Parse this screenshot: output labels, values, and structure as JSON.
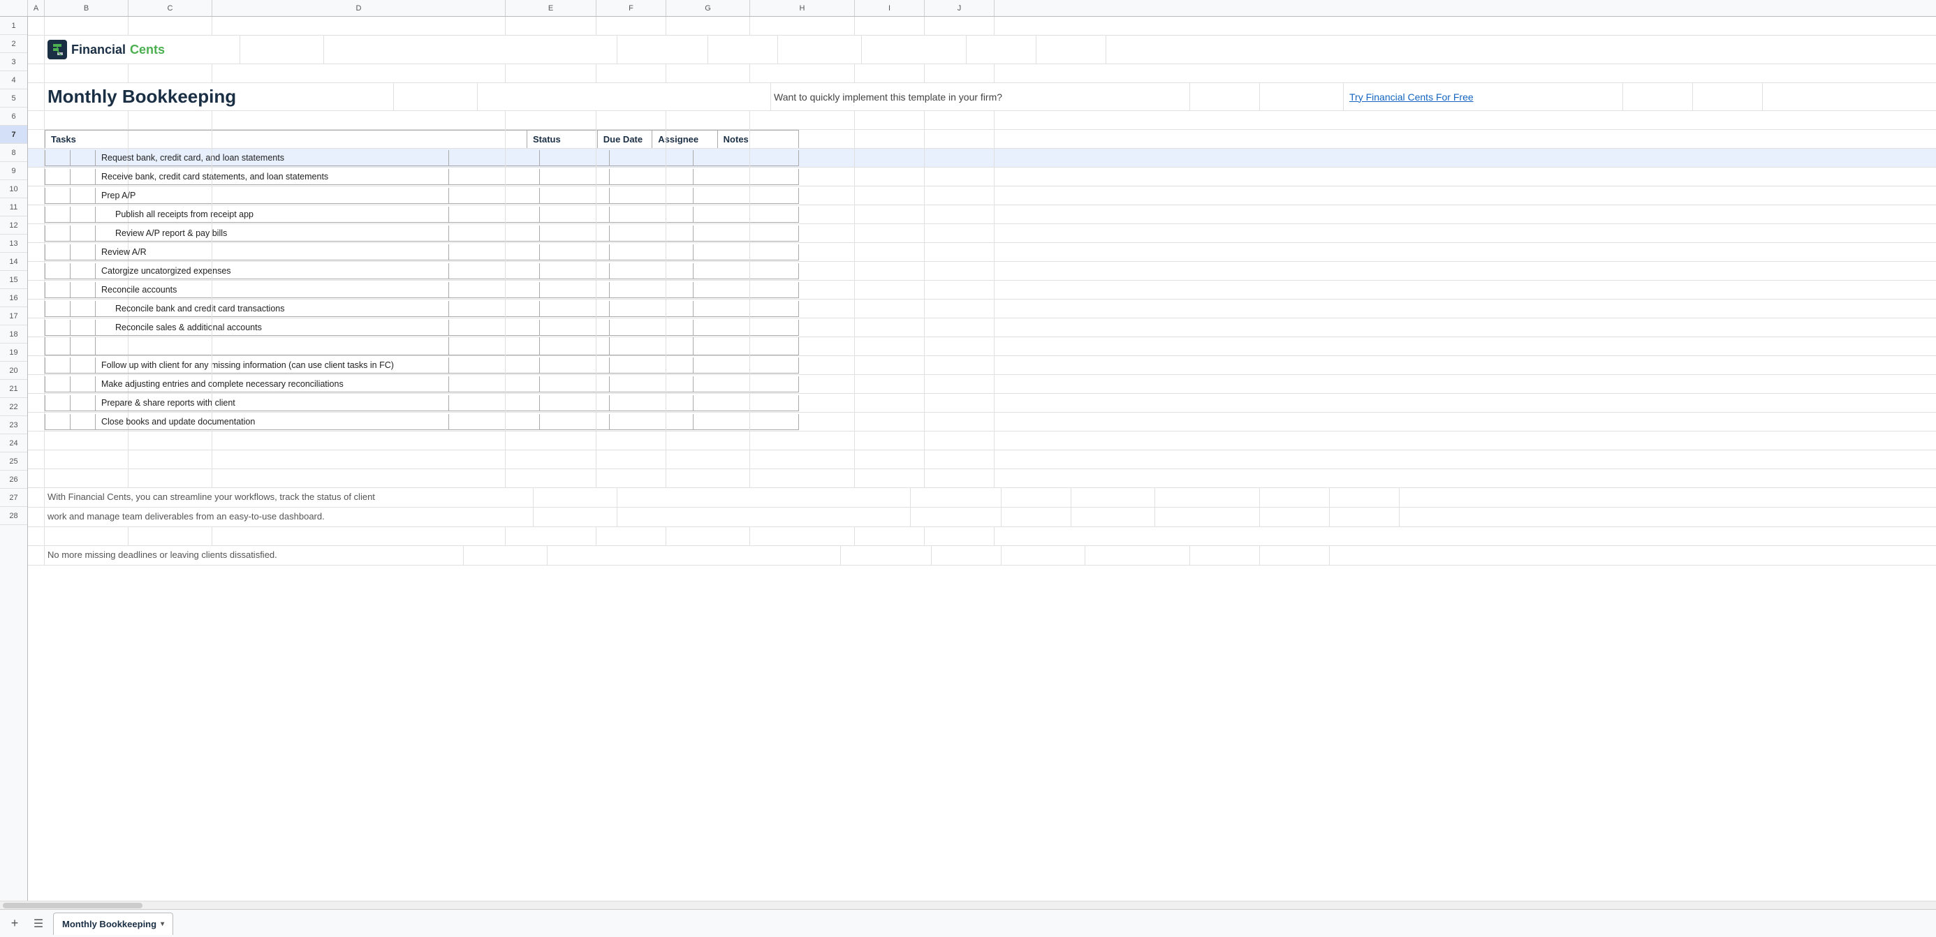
{
  "brand": {
    "name_financial": "Financial",
    "name_cents": "Cents",
    "logo_alt": "FinancialCents logo"
  },
  "header": {
    "title": "Monthly Bookkeeping",
    "cta_text": "Want to quickly implement this template in your firm?",
    "cta_link_text": "Try Financial Cents For Free"
  },
  "columns": {
    "letters": [
      "A",
      "B",
      "C",
      "D",
      "E",
      "F",
      "G",
      "H",
      "I",
      "J"
    ]
  },
  "row_numbers": [
    1,
    2,
    3,
    4,
    5,
    6,
    7,
    8,
    9,
    10,
    11,
    12,
    13,
    14,
    15,
    16,
    17,
    18,
    19,
    20,
    21,
    22,
    23,
    24,
    25,
    26,
    27,
    28
  ],
  "selected_row": 7,
  "table": {
    "headers": [
      "Tasks",
      "Status",
      "Due Date",
      "Assignee",
      "Notes"
    ],
    "rows": [
      {
        "indent": 0,
        "task": "Request bank, credit card, and loan statements",
        "status": "",
        "due_date": "",
        "assignee": "",
        "notes": ""
      },
      {
        "indent": 0,
        "task": "Receive bank, credit card statements, and loan statements",
        "status": "",
        "due_date": "",
        "assignee": "",
        "notes": ""
      },
      {
        "indent": 0,
        "task": "Prep A/P",
        "status": "",
        "due_date": "",
        "assignee": "",
        "notes": ""
      },
      {
        "indent": 1,
        "task": "Publish all receipts from receipt app",
        "status": "",
        "due_date": "",
        "assignee": "",
        "notes": ""
      },
      {
        "indent": 1,
        "task": "Review A/P report & pay bills",
        "status": "",
        "due_date": "",
        "assignee": "",
        "notes": ""
      },
      {
        "indent": 0,
        "task": "Review A/R",
        "status": "",
        "due_date": "",
        "assignee": "",
        "notes": ""
      },
      {
        "indent": 0,
        "task": "Catorgize uncatorgized expenses",
        "status": "",
        "due_date": "",
        "assignee": "",
        "notes": ""
      },
      {
        "indent": 0,
        "task": "Reconcile accounts",
        "status": "",
        "due_date": "",
        "assignee": "",
        "notes": ""
      },
      {
        "indent": 1,
        "task": "Reconcile bank and credit card transactions",
        "status": "",
        "due_date": "",
        "assignee": "",
        "notes": ""
      },
      {
        "indent": 1,
        "task": "Reconcile sales & additional accounts",
        "status": "",
        "due_date": "",
        "assignee": "",
        "notes": ""
      },
      {
        "indent": 0,
        "task": "",
        "status": "",
        "due_date": "",
        "assignee": "",
        "notes": ""
      },
      {
        "indent": 0,
        "task": "Follow up with client for any missing information (can use client tasks in FC)",
        "status": "",
        "due_date": "",
        "assignee": "",
        "notes": ""
      },
      {
        "indent": 0,
        "task": "Make adjusting entries and complete necessary reconciliations",
        "status": "",
        "due_date": "",
        "assignee": "",
        "notes": ""
      },
      {
        "indent": 0,
        "task": "Prepare & share reports with client",
        "status": "",
        "due_date": "",
        "assignee": "",
        "notes": ""
      },
      {
        "indent": 0,
        "task": "Close books and update documentation",
        "status": "",
        "due_date": "",
        "assignee": "",
        "notes": ""
      }
    ]
  },
  "promo": {
    "line1": "With Financial Cents, you can streamline your workflows, track the status of client",
    "line2": "work and manage team deliverables from an easy-to-use dashboard.",
    "line3": "",
    "line4": "No more missing deadlines or leaving clients dissatisfied."
  },
  "tab": {
    "name": "Monthly Bookkeeping"
  }
}
